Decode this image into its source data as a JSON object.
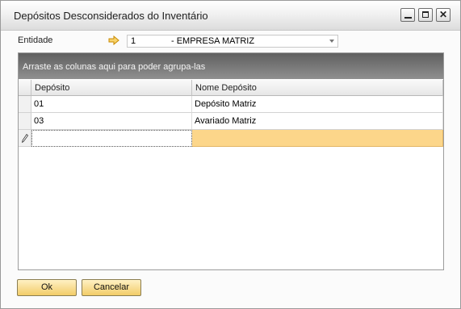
{
  "window": {
    "title": "Depósitos Desconsiderados do Inventário"
  },
  "title_buttons": [
    "minimize-icon",
    "maximize-icon",
    "close-icon"
  ],
  "entity": {
    "label": "Entidade",
    "code": "1",
    "name": "- EMPRESA MATRIZ",
    "link_icon": "orange-arrow-icon"
  },
  "grid": {
    "group_hint": "Arraste as colunas aqui para poder agrupa-las",
    "columns": [
      "Depósito",
      "Nome Depósito"
    ],
    "rows": [
      {
        "code": "01",
        "name": "Depósito Matriz"
      },
      {
        "code": "03",
        "name": "Avariado Matriz"
      }
    ],
    "new_row": {
      "code": "",
      "name": ""
    }
  },
  "buttons": {
    "ok": "Ok",
    "cancel": "Cancelar"
  },
  "colors": {
    "accent_button": "#f2cc68",
    "new_row": "#fcd68a",
    "group_bar": "#707070"
  }
}
